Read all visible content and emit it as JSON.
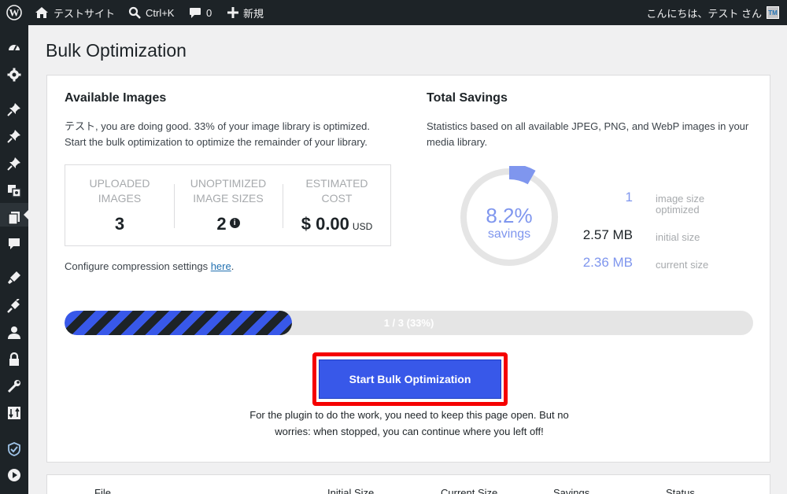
{
  "adminbar": {
    "site_name": "テストサイト",
    "search_shortcut": "Ctrl+K",
    "comments_count": "0",
    "new_label": "新規",
    "greeting": "こんにちは、テスト さん",
    "avatar_initials": "TM"
  },
  "sidebar": {
    "icons": [
      "dashboard-icon",
      "settings-icon",
      "pin-icon",
      "pin-icon",
      "pin-icon",
      "media-icon",
      "pages-icon",
      "comments-icon",
      "appearance-icon",
      "plugins-icon",
      "users-icon",
      "lock-icon",
      "tools-icon",
      "import-icon",
      "shield-check-icon",
      "play-icon"
    ],
    "current_item": "media-icon"
  },
  "page": {
    "title": "Bulk Optimization"
  },
  "available": {
    "heading": "Available Images",
    "text_line1": "テスト, you are doing good. 33% of your image library is optimized.",
    "text_line2": "Start the bulk optimization to optimize the remainder of your library.",
    "stats": [
      {
        "label_line1": "UPLOADED",
        "label_line2": "IMAGES",
        "value": "3"
      },
      {
        "label_line1": "UNOPTIMIZED",
        "label_line2": "IMAGE SIZES",
        "value": "2"
      },
      {
        "label_line1": "ESTIMATED",
        "label_line2": "COST",
        "value": "$ 0.00",
        "unit": "USD"
      }
    ],
    "configure_prefix": "Configure compression settings ",
    "configure_link": "here",
    "configure_suffix": "."
  },
  "savings": {
    "heading": "Total Savings",
    "text_line1": "Statistics based on all available JPEG, PNG, and WebP images in your",
    "text_line2": "media library.",
    "percent": "8.2%",
    "percent_value": 8.2,
    "percent_label": "savings",
    "optimized_count": "1",
    "optimized_label_line1": "image size",
    "optimized_label_line2": "optimized",
    "initial_size": "2.57 MB",
    "initial_label": "initial size",
    "current_size": "2.36 MB",
    "current_label": "current size"
  },
  "progress": {
    "text": "1 / 3 (33%)",
    "fraction": 0.33
  },
  "action": {
    "button_label": "Start Bulk Optimization",
    "note_line1": "For the plugin to do the work, you need to keep this page open. But no",
    "note_line2": "worries: when stopped, you can continue where you left off!"
  },
  "table": {
    "headers": [
      "File",
      "Initial Size",
      "Current Size",
      "Savings",
      "Status"
    ]
  },
  "colors": {
    "accent": "#3858e9",
    "donut": "#7f96ee",
    "highlight": "#f50000",
    "adminbar": "#1d2327"
  }
}
